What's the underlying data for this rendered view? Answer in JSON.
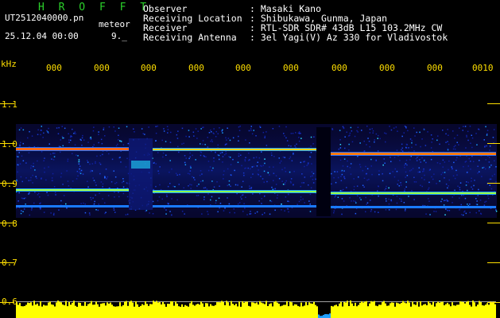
{
  "header": {
    "title": "H R O F F T",
    "filename": "UT2512040000.pn",
    "meteor_label": "meteor",
    "date_time": "25.12.04 00:00",
    "count": "9._"
  },
  "info": [
    {
      "label": "Observer",
      "value": ": Masaki Kano"
    },
    {
      "label": "Receiving Location",
      "value": ": Shibukawa, Gunma, Japan"
    },
    {
      "label": "Receiver",
      "value": ": RTL-SDR SDR# 43dB L15 103.2MHz CW"
    },
    {
      "label": "Receiving Antenna",
      "value": ": 3el Yagi(V) Az 330 for Vladivostok"
    }
  ],
  "axis": {
    "unit": "kHz",
    "y_labels": [
      "1.1",
      "1.0",
      "0.9",
      "0.8",
      "0.7",
      "0.6"
    ],
    "x_labels": [
      "000",
      "000",
      "000",
      "000",
      "000",
      "000",
      "000",
      "000",
      "000",
      "0010"
    ]
  },
  "colors": {
    "axis": "#ffdf00",
    "title": "#2bd12b",
    "text": "#ffffff",
    "background": "#000000",
    "spectrum_base": "#0a0a4a",
    "level_bar": "#ffff00"
  }
}
